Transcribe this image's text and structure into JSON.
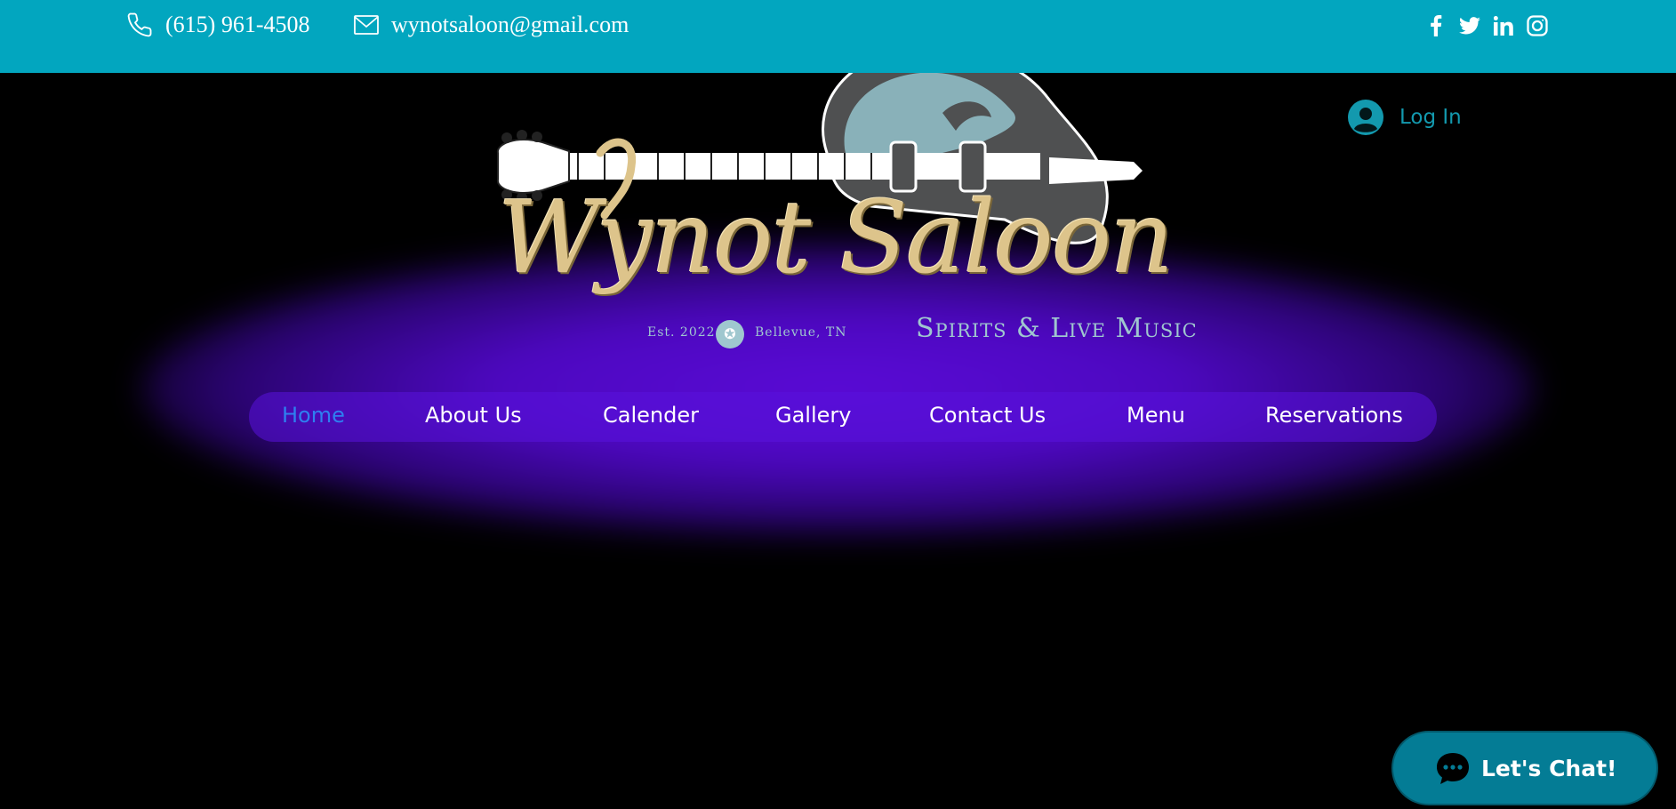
{
  "topbar": {
    "phone": "(615) 961-4508",
    "email": "wynotsaloon@gmail.com",
    "social": [
      "facebook-icon",
      "twitter-icon",
      "linkedin-icon",
      "instagram-icon"
    ],
    "color": "#02a6bf"
  },
  "logo": {
    "title": "Wynot Saloon",
    "established": "Est. 2022",
    "location": "Bellevue, TN",
    "tagline": "Spirits & Live Music"
  },
  "login": {
    "label": "Log In"
  },
  "nav": {
    "items": [
      {
        "label": "Home",
        "active": true
      },
      {
        "label": "About Us"
      },
      {
        "label": "Calender"
      },
      {
        "label": "Gallery"
      },
      {
        "label": "Contact Us"
      },
      {
        "label": "Menu"
      },
      {
        "label": "Reservations"
      }
    ]
  },
  "chat": {
    "label": "Let's Chat!"
  },
  "colors": {
    "accent": "#02a6bf",
    "glow": "#5a0bd6",
    "active_nav": "#2e7ff0"
  }
}
